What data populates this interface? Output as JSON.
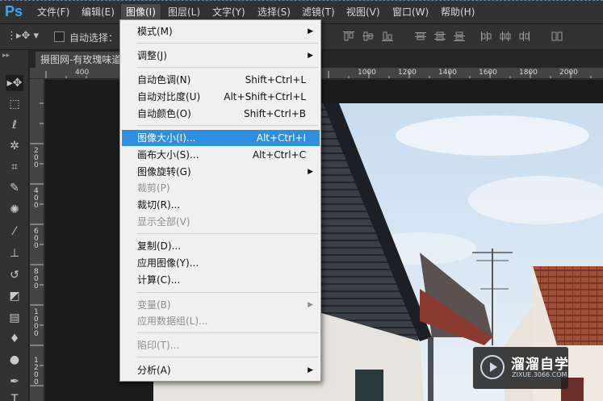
{
  "app": {
    "logo": "Ps"
  },
  "menubar": {
    "items": [
      {
        "label": "文件(F)"
      },
      {
        "label": "编辑(E)"
      },
      {
        "label": "图像(I)"
      },
      {
        "label": "图层(L)"
      },
      {
        "label": "文字(Y)"
      },
      {
        "label": "选择(S)"
      },
      {
        "label": "滤镜(T)"
      },
      {
        "label": "视图(V)"
      },
      {
        "label": "窗口(W)"
      },
      {
        "label": "帮助(H)"
      }
    ],
    "active_index": 2
  },
  "options": {
    "auto_select_label": "自动选择：",
    "auto_select_checked": false
  },
  "document": {
    "tab_title": "摄图网-有玫瑰味道"
  },
  "ruler": {
    "top_labels": [
      "400",
      "1000",
      "1200",
      "1400",
      "1600",
      "1800",
      "2000"
    ],
    "left_labels": [
      "200",
      "400",
      "600",
      "800",
      "1000",
      "1200"
    ]
  },
  "image_menu": {
    "items": [
      {
        "label": "模式(M)",
        "shortcut": "",
        "submenu": true,
        "disabled": false,
        "highlighted": false
      },
      {
        "label": "调整(J)",
        "shortcut": "",
        "submenu": true,
        "disabled": false,
        "highlighted": false
      },
      {
        "label": "自动色调(N)",
        "shortcut": "Shift+Ctrl+L",
        "submenu": false,
        "disabled": false,
        "highlighted": false
      },
      {
        "label": "自动对比度(U)",
        "shortcut": "Alt+Shift+Ctrl+L",
        "submenu": false,
        "disabled": false,
        "highlighted": false
      },
      {
        "label": "自动颜色(O)",
        "shortcut": "Shift+Ctrl+B",
        "submenu": false,
        "disabled": false,
        "highlighted": false
      },
      {
        "label": "图像大小(I)...",
        "shortcut": "Alt+Ctrl+I",
        "submenu": false,
        "disabled": false,
        "highlighted": true
      },
      {
        "label": "画布大小(S)...",
        "shortcut": "Alt+Ctrl+C",
        "submenu": false,
        "disabled": false,
        "highlighted": false
      },
      {
        "label": "图像旋转(G)",
        "shortcut": "",
        "submenu": true,
        "disabled": false,
        "highlighted": false
      },
      {
        "label": "裁剪(P)",
        "shortcut": "",
        "submenu": false,
        "disabled": true,
        "highlighted": false
      },
      {
        "label": "裁切(R)...",
        "shortcut": "",
        "submenu": false,
        "disabled": false,
        "highlighted": false
      },
      {
        "label": "显示全部(V)",
        "shortcut": "",
        "submenu": false,
        "disabled": true,
        "highlighted": false
      },
      {
        "label": "复制(D)...",
        "shortcut": "",
        "submenu": false,
        "disabled": false,
        "highlighted": false
      },
      {
        "label": "应用图像(Y)...",
        "shortcut": "",
        "submenu": false,
        "disabled": false,
        "highlighted": false
      },
      {
        "label": "计算(C)...",
        "shortcut": "",
        "submenu": false,
        "disabled": false,
        "highlighted": false
      },
      {
        "label": "变量(B)",
        "shortcut": "",
        "submenu": true,
        "disabled": true,
        "highlighted": false
      },
      {
        "label": "应用数据组(L)...",
        "shortcut": "",
        "submenu": false,
        "disabled": true,
        "highlighted": false
      },
      {
        "label": "陷印(T)...",
        "shortcut": "",
        "submenu": false,
        "disabled": true,
        "highlighted": false
      },
      {
        "label": "分析(A)",
        "shortcut": "",
        "submenu": true,
        "disabled": false,
        "highlighted": false
      }
    ]
  },
  "watermark": {
    "title": "溜溜自学",
    "url": "ZIXUE.3066.COM"
  },
  "colors": {
    "accent": "#2f8fde",
    "ps_logo": "#31a8ff"
  }
}
